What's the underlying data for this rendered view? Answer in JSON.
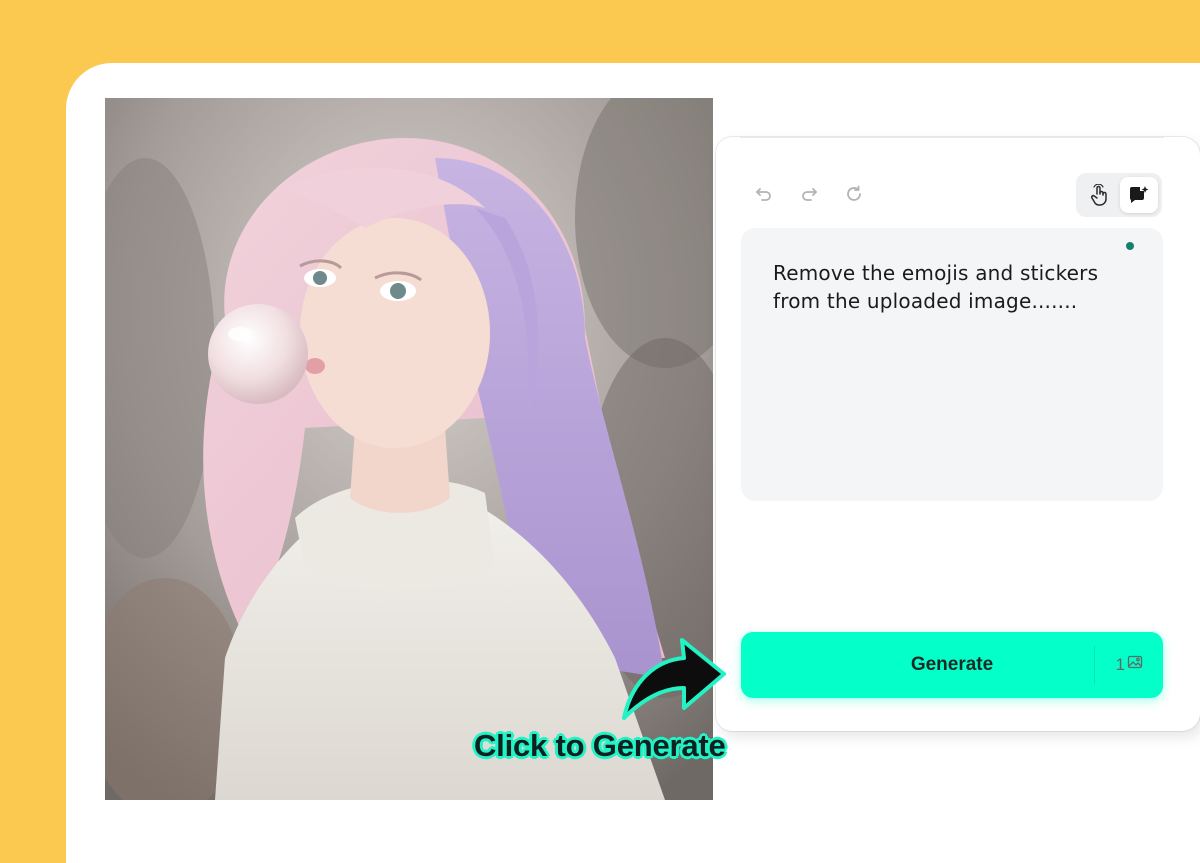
{
  "colors": {
    "background": "#fbc94f",
    "card": "#ffffff",
    "accent": "#04ffc9",
    "prompt_bg": "#f4f5f7",
    "status_dot": "#14806a"
  },
  "toolbar": {
    "undo_icon": "undo-icon",
    "redo_icon": "redo-icon",
    "reset_icon": "refresh-icon"
  },
  "mode_toggle": {
    "options": [
      {
        "icon": "hand-pointer-icon",
        "active": false
      },
      {
        "icon": "chat-sparkle-icon",
        "active": true
      }
    ]
  },
  "prompt": {
    "text": "Remove the emojis and stickers from the uploaded image......."
  },
  "generate": {
    "label": "Generate",
    "credits": "1",
    "credit_icon": "image-icon"
  },
  "callout": {
    "text": "Click to Generate",
    "arrow_icon": "curved-arrow-icon"
  }
}
